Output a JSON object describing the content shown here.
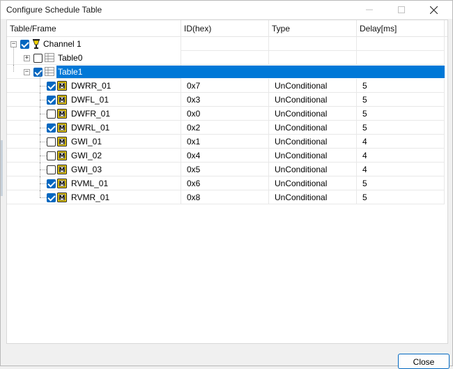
{
  "window": {
    "title": "Configure Schedule Table",
    "minimize_glyph": "minimize-icon",
    "maximize_glyph": "maximize-icon",
    "close_glyph": "close-icon"
  },
  "table": {
    "columns": [
      "Table/Frame",
      "ID(hex)",
      "Type",
      "Delay[ms]"
    ],
    "channel": {
      "label": "Channel 1",
      "checked": true,
      "expanded": true,
      "icon": "channel-icon"
    },
    "tables": [
      {
        "label": "Table0",
        "checked": false,
        "expanded": false,
        "icon": "table-icon"
      },
      {
        "label": "Table1",
        "checked": true,
        "expanded": true,
        "selected": true,
        "icon": "table-icon"
      }
    ],
    "frames": [
      {
        "name": "DWRR_01",
        "checked": true,
        "id": "0x7",
        "type": "UnConditional",
        "delay": "5"
      },
      {
        "name": "DWFL_01",
        "checked": true,
        "id": "0x3",
        "type": "UnConditional",
        "delay": "5"
      },
      {
        "name": "DWFR_01",
        "checked": false,
        "id": "0x0",
        "type": "UnConditional",
        "delay": "5"
      },
      {
        "name": "DWRL_01",
        "checked": true,
        "id": "0x2",
        "type": "UnConditional",
        "delay": "5"
      },
      {
        "name": "GWI_01",
        "checked": false,
        "id": "0x1",
        "type": "UnConditional",
        "delay": "4"
      },
      {
        "name": "GWI_02",
        "checked": false,
        "id": "0x4",
        "type": "UnConditional",
        "delay": "4"
      },
      {
        "name": "GWI_03",
        "checked": false,
        "id": "0x5",
        "type": "UnConditional",
        "delay": "4"
      },
      {
        "name": "RVML_01",
        "checked": true,
        "id": "0x6",
        "type": "UnConditional",
        "delay": "5"
      },
      {
        "name": "RVMR_01",
        "checked": true,
        "id": "0x8",
        "type": "UnConditional",
        "delay": "5"
      }
    ]
  },
  "footer": {
    "close_label": "Close"
  },
  "colors": {
    "selection": "#0078d7",
    "checkbox_checked": "#0067c0",
    "frame_icon": "#f2d200"
  }
}
